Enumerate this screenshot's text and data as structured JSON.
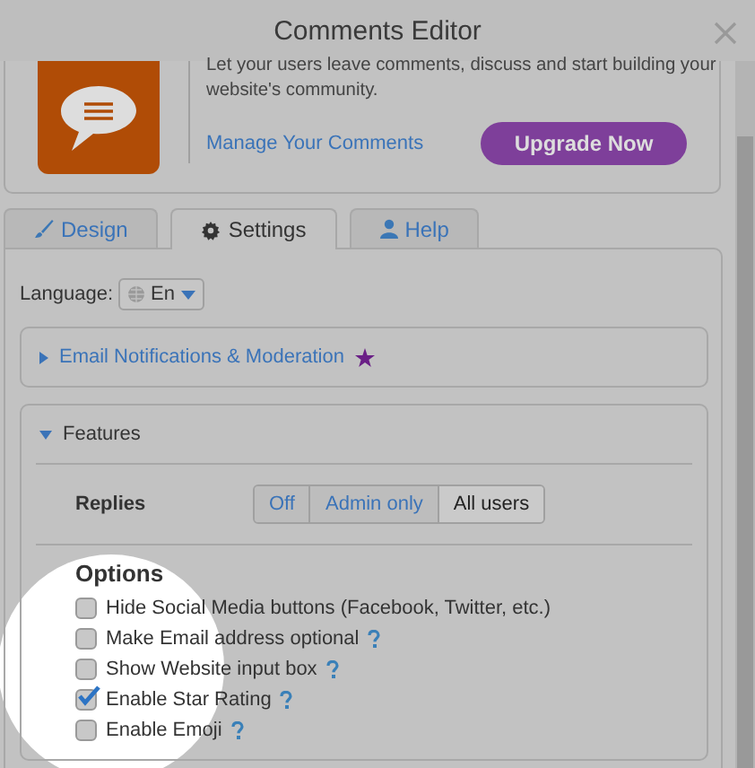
{
  "window": {
    "title": "Comments Editor"
  },
  "app": {
    "description": "Let your users leave comments, discuss and start building your website's community.",
    "link": "Manage Your Comments",
    "upgrade_button": "Upgrade Now"
  },
  "tabs": [
    {
      "label": "Design",
      "selected": false
    },
    {
      "label": "Settings",
      "selected": true
    },
    {
      "label": "Help",
      "selected": false
    }
  ],
  "language": {
    "label": "Language:",
    "value": "En"
  },
  "sections": [
    {
      "title": "Email Notifications & Moderation",
      "expanded": false,
      "premium": true
    },
    {
      "title": "Features",
      "expanded": true,
      "premium": false
    }
  ],
  "replies": {
    "label": "Replies",
    "options": [
      {
        "label": "Off",
        "selected": false
      },
      {
        "label": "Admin only",
        "selected": false
      },
      {
        "label": "All users",
        "selected": true
      }
    ]
  },
  "options": {
    "title": "Options",
    "items": [
      {
        "label": "Hide Social Media buttons (Facebook, Twitter, etc.)",
        "checked": false,
        "help": false
      },
      {
        "label": "Make Email address optional",
        "checked": false,
        "help": true
      },
      {
        "label": "Show Website input box",
        "checked": false,
        "help": true
      },
      {
        "label": "Enable Star Rating",
        "checked": true,
        "help": true
      },
      {
        "label": "Enable Emoji",
        "checked": false,
        "help": true
      }
    ]
  }
}
